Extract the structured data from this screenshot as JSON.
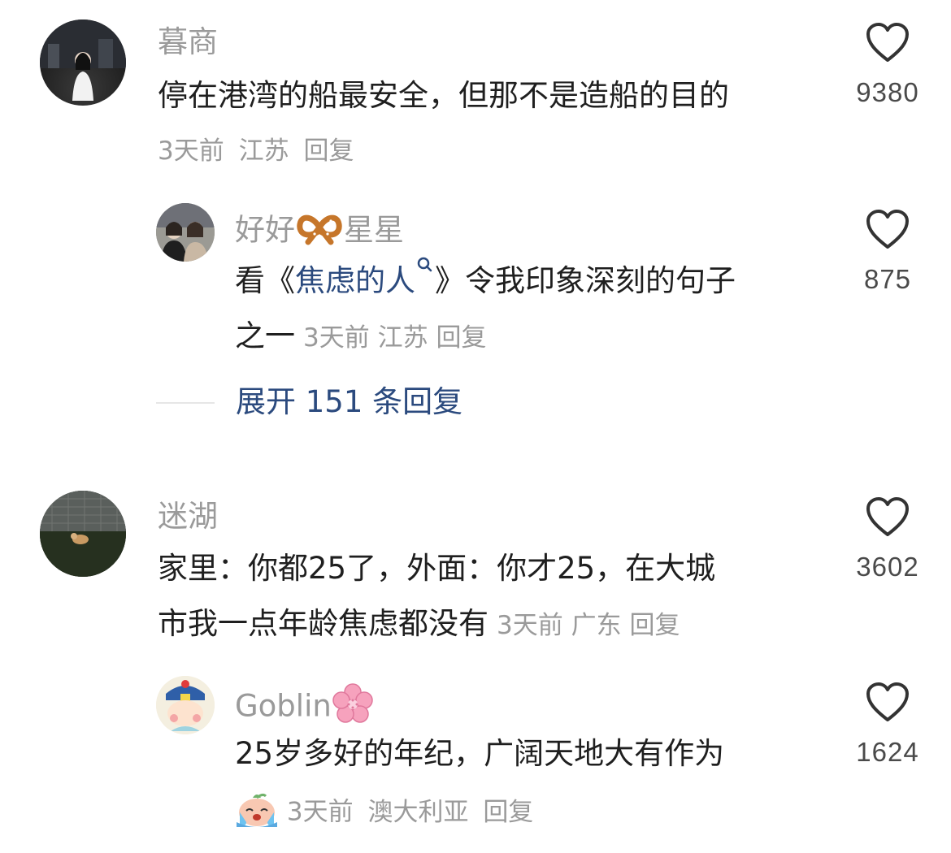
{
  "comments": [
    {
      "username": "暮商",
      "text": "停在港湾的船最安全，但那不是造船的目的",
      "time": "3天前",
      "location": "江苏",
      "reply_label": "回复",
      "likes": "9380",
      "replies": [
        {
          "username_prefix": "好好",
          "username_emoji": "pretzel-emoji",
          "username_suffix": "星星",
          "text_before": "看《",
          "link_text": "焦虑的人",
          "text_after": "》令我印象深刻的句子",
          "text_line2": "之一",
          "time": "3天前",
          "location": "江苏",
          "reply_label": "回复",
          "likes": "875"
        }
      ],
      "expand_label": "展开 151 条回复"
    },
    {
      "username": "迷湖",
      "text_line1": "家里：你都25了，外面：你才25，在大城",
      "text_line2": "市我一点年龄焦虑都没有",
      "time": "3天前",
      "location": "广东",
      "reply_label": "回复",
      "likes": "3602",
      "replies": [
        {
          "username": "Goblin",
          "username_emoji": "cherry-blossom-emoji",
          "text": "25岁多好的年纪，广阔天地大有作为",
          "sticker": "crying-peach-sticker",
          "time": "3天前",
          "location": "澳大利亚",
          "reply_label": "回复",
          "likes": "1624"
        }
      ]
    }
  ],
  "colors": {
    "username": "#9a9a9a",
    "text": "#1f1f1f",
    "meta": "#9a9a9a",
    "link": "#2b4a7e",
    "heart": "#333333"
  }
}
